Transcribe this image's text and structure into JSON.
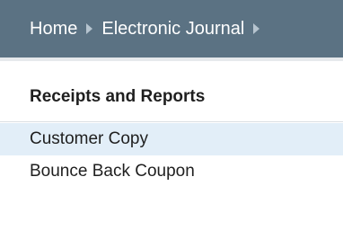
{
  "breadcrumb": {
    "items": [
      "Home",
      "Electronic Journal"
    ],
    "separator_icon": "triangle-right-icon"
  },
  "section": {
    "title": "Receipts and Reports"
  },
  "menu": {
    "items": [
      {
        "label": "Customer Copy",
        "selected": true
      },
      {
        "label": "Bounce Back Coupon",
        "selected": false
      }
    ]
  },
  "colors": {
    "header_bg": "#5b7283",
    "selected_bg": "#e2eef8"
  }
}
